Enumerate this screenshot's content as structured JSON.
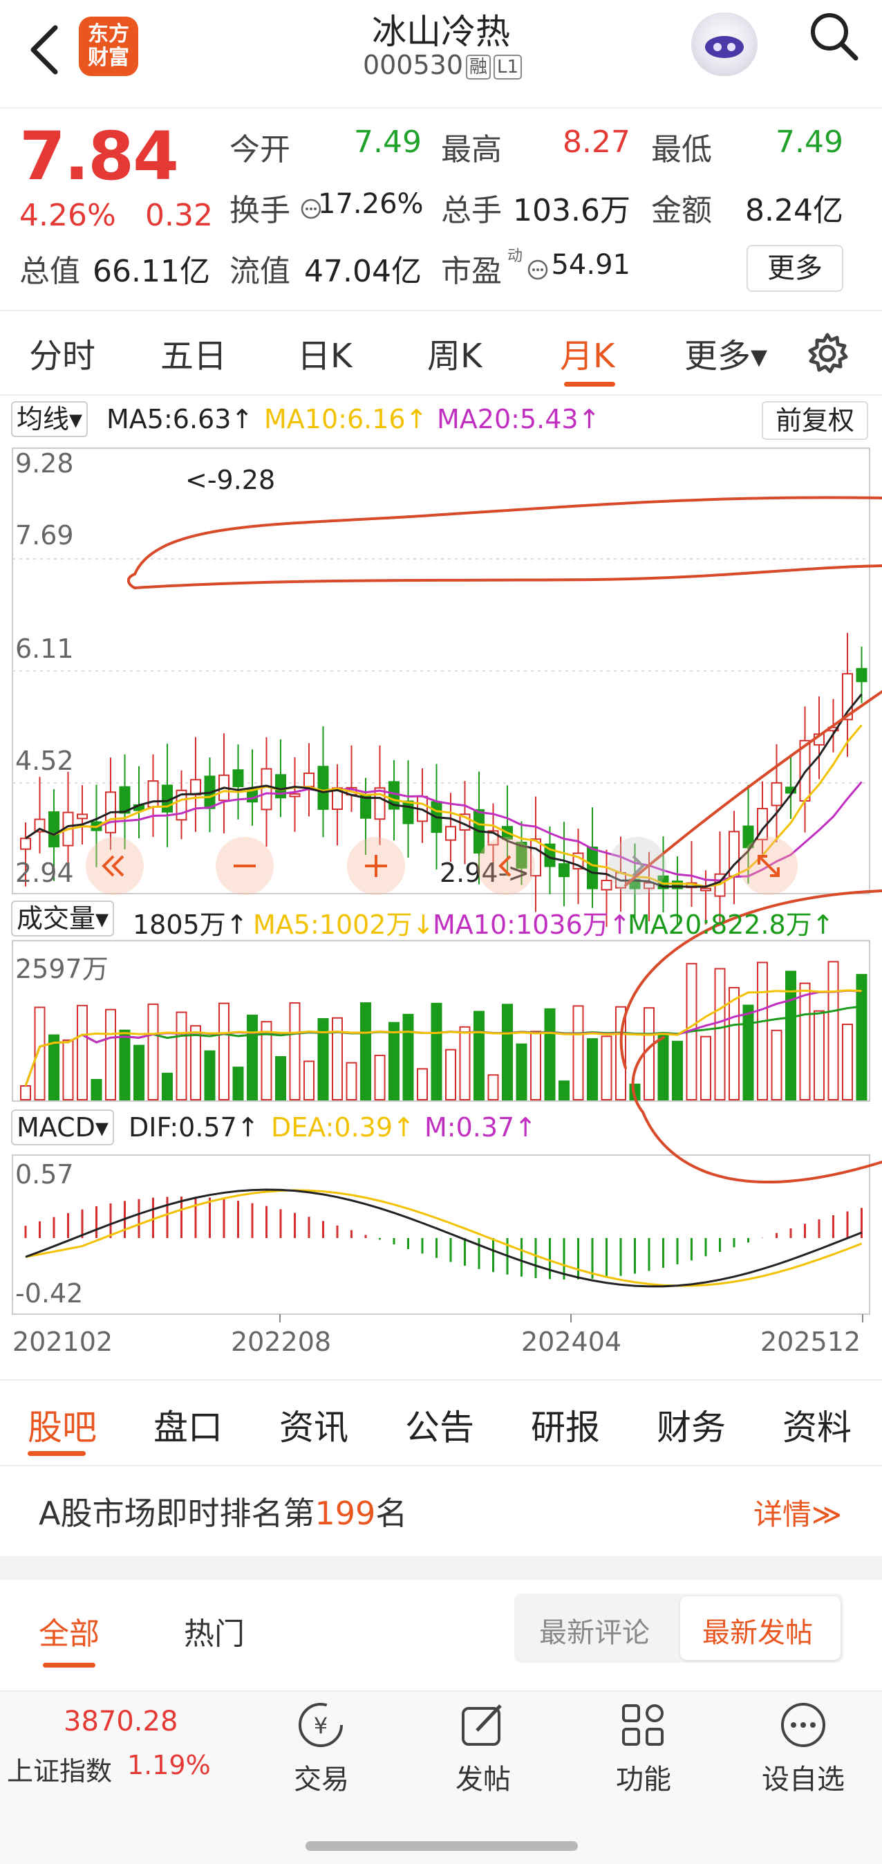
{
  "header": {
    "title": "冰山冷热",
    "code": "000530",
    "tag1": "融",
    "tag2": "L1",
    "logo_line1": "东方",
    "logo_line2": "财富"
  },
  "quote": {
    "price": "7.84",
    "change_pct": "4.26%",
    "change_abs": "0.32",
    "open_label": "今开",
    "open": "7.49",
    "high_label": "最高",
    "high": "8.27",
    "low_label": "最低",
    "low": "7.49",
    "turnover_label": "换手",
    "turnover": "17.26%",
    "volume_label": "总手",
    "volume": "103.6万",
    "amount_label": "金额",
    "amount": "8.24亿",
    "mktcap_label": "总值",
    "mktcap": "66.11亿",
    "float_label": "流值",
    "float": "47.04亿",
    "pe_label": "市盈",
    "pe_sup": "动",
    "pe": "54.91",
    "more": "更多"
  },
  "tabs": {
    "t1": "分时",
    "t2": "五日",
    "t3": "日K",
    "t4": "周K",
    "t5": "月K",
    "t6": "更多▾"
  },
  "kline": {
    "ma_select": "均线▾",
    "ma5": "MA5:6.63↑",
    "ma10": "MA10:6.16↑",
    "ma20": "MA20:5.43↑",
    "adjust": "前复权",
    "y_labels": [
      "9.28",
      "7.69",
      "6.11",
      "4.52",
      "2.94"
    ],
    "high_note": "<-9.28",
    "low_note": "2.94->",
    "colors": {
      "up": "#d32f2f",
      "down": "#1a9c1a",
      "ma5": "#222222",
      "ma10": "#f2c200",
      "ma20": "#c02fc0",
      "annot": "#d84a2a"
    }
  },
  "volume": {
    "select": "成交量▾",
    "current": "1805万↑",
    "ma5": "MA5:1002万↓",
    "ma10": "MA10:1036万↑",
    "ma20": "MA20:822.8万↑",
    "y_top": "2597万"
  },
  "macd": {
    "select": "MACD▾",
    "dif": "DIF:0.57↑",
    "dea": "DEA:0.39↑",
    "m": "M:0.37↑",
    "y_top": "0.57",
    "y_bottom": "-0.42"
  },
  "x_labels": [
    "202102",
    "202208",
    "202404",
    "202512"
  ],
  "bottom_tabs": [
    "股吧",
    "盘口",
    "资讯",
    "公告",
    "研报",
    "财务",
    "资料"
  ],
  "rank": {
    "prefix": "A股市场即时排名第",
    "num": "199",
    "suffix": "名",
    "detail": "详情≫"
  },
  "filter": {
    "all": "全部",
    "hot": "热门",
    "latest_comment": "最新评论",
    "latest_post": "最新发帖"
  },
  "dock": {
    "index_value": "3870.28",
    "index_name": "上证指数",
    "index_chg": "1.19%",
    "trade": "交易",
    "post": "发帖",
    "func": "功能",
    "watch": "设自选"
  }
}
